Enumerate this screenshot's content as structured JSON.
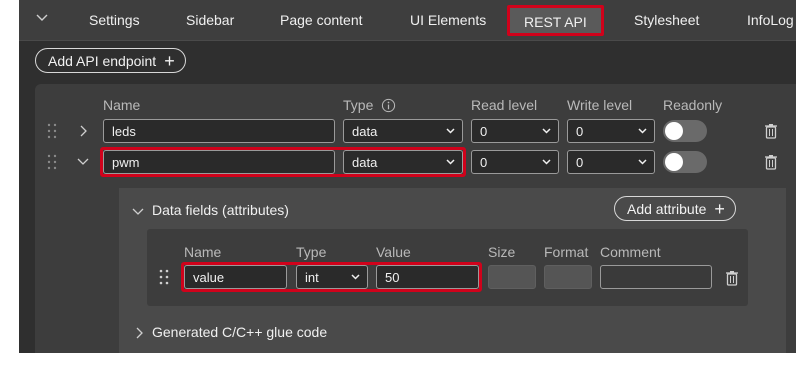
{
  "tabs": [
    {
      "label": "Settings"
    },
    {
      "label": "Sidebar"
    },
    {
      "label": "Page content"
    },
    {
      "label": "UI Elements"
    },
    {
      "label": "REST API"
    },
    {
      "label": "Stylesheet"
    },
    {
      "label": "InfoLog"
    }
  ],
  "active_tab": "REST API",
  "add_endpoint_label": "Add API endpoint",
  "endpoint_headers": {
    "name": "Name",
    "type": "Type",
    "read_level": "Read level",
    "write_level": "Write level",
    "readonly": "Readonly"
  },
  "endpoints": [
    {
      "name": "leds",
      "type": "data",
      "read_level": "0",
      "write_level": "0",
      "readonly": false,
      "expanded": false
    },
    {
      "name": "pwm",
      "type": "data",
      "read_level": "0",
      "write_level": "0",
      "readonly": false,
      "expanded": true
    }
  ],
  "data_fields": {
    "title": "Data fields (attributes)",
    "add_attribute_label": "Add attribute",
    "headers": {
      "name": "Name",
      "type": "Type",
      "value": "Value",
      "size": "Size",
      "format": "Format",
      "comment": "Comment"
    },
    "rows": [
      {
        "name": "value",
        "type": "int",
        "value": "50",
        "size": "",
        "format": "",
        "comment": ""
      }
    ]
  },
  "glue_code_label": "Generated C/C++ glue code",
  "colors": {
    "highlight": "#d0021b",
    "background": "#2f2f2f"
  }
}
